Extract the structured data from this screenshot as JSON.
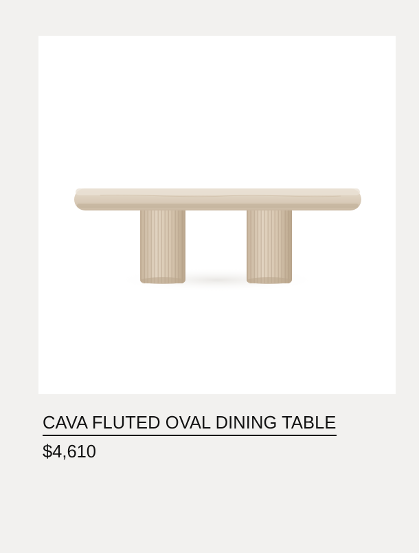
{
  "product": {
    "image_alt": "Cava Fluted Oval Dining Table product image",
    "title": "CAVA FLUTED OVAL DINING TABLE",
    "price": "$4,610"
  },
  "colors": {
    "page_background": "#f2f1ef",
    "image_background": "#ffffff",
    "text": "#111111",
    "stone": "#d8c9b6"
  }
}
